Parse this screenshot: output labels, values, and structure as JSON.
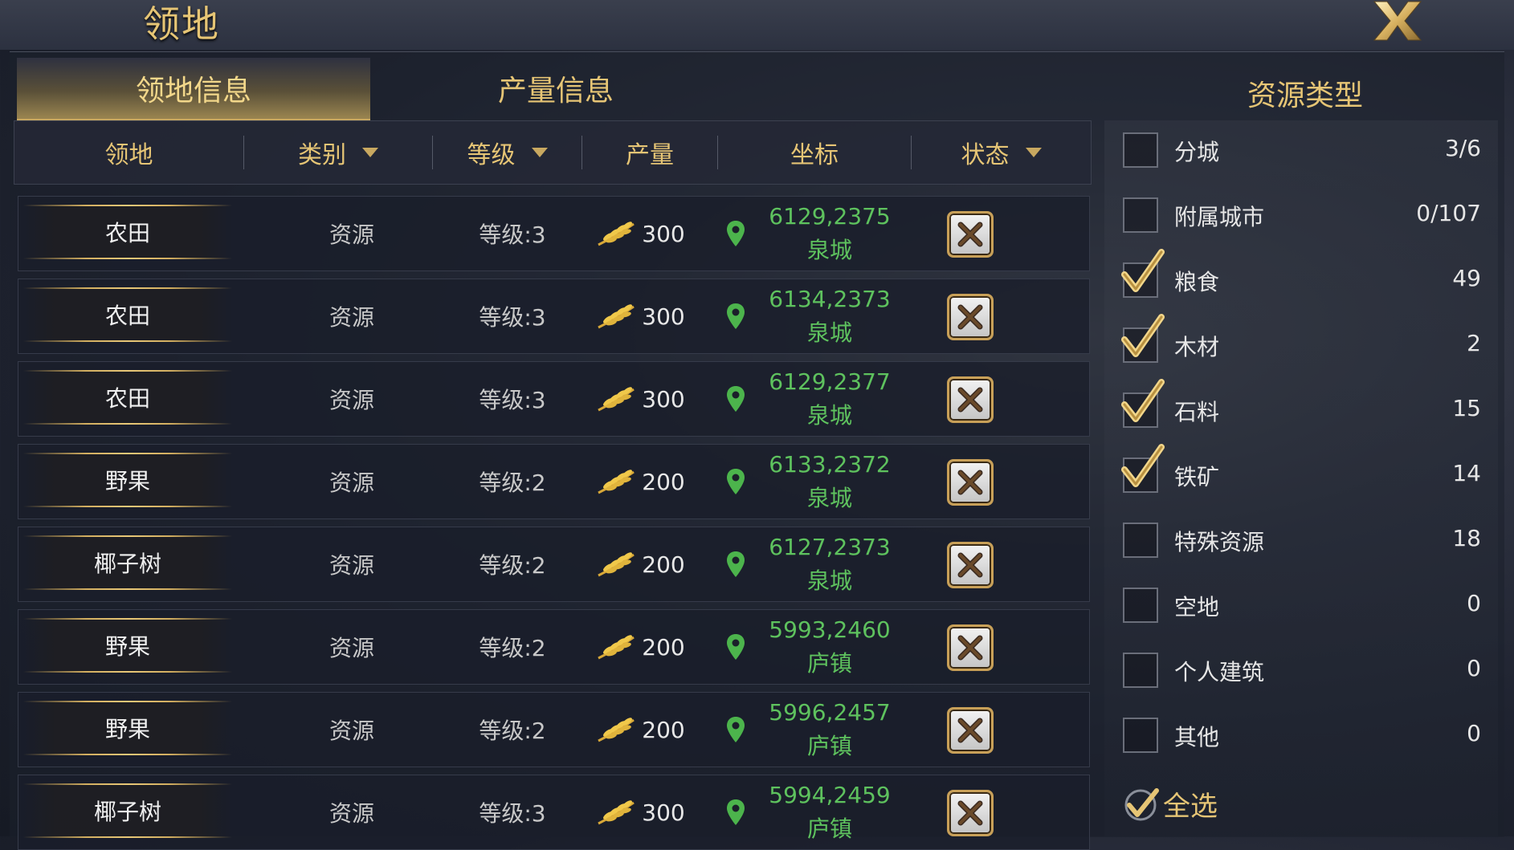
{
  "window": {
    "title": "领地"
  },
  "tabs": [
    {
      "label": "领地信息",
      "active": true
    },
    {
      "label": "产量信息",
      "active": false
    }
  ],
  "filter": {
    "title": "资源类型",
    "items": [
      {
        "label": "分城",
        "count": "3/6",
        "checked": false
      },
      {
        "label": "附属城市",
        "count": "0/107",
        "checked": false
      },
      {
        "label": "粮食",
        "count": "49",
        "checked": true
      },
      {
        "label": "木材",
        "count": "2",
        "checked": true
      },
      {
        "label": "石料",
        "count": "15",
        "checked": true
      },
      {
        "label": "铁矿",
        "count": "14",
        "checked": true
      },
      {
        "label": "特殊资源",
        "count": "18",
        "checked": false
      },
      {
        "label": "空地",
        "count": "0",
        "checked": false
      },
      {
        "label": "个人建筑",
        "count": "0",
        "checked": false
      },
      {
        "label": "其他",
        "count": "0",
        "checked": false
      }
    ],
    "select_all_label": "全选"
  },
  "table": {
    "columns": {
      "territory": "领地",
      "category": "类别",
      "level": "等级",
      "output": "产量",
      "coordinates": "坐标",
      "status": "状态"
    },
    "rows": [
      {
        "name": "农田",
        "category": "资源",
        "level": "等级:3",
        "output": "300",
        "coord": "6129,2375",
        "city": "泉城"
      },
      {
        "name": "农田",
        "category": "资源",
        "level": "等级:3",
        "output": "300",
        "coord": "6134,2373",
        "city": "泉城"
      },
      {
        "name": "农田",
        "category": "资源",
        "level": "等级:3",
        "output": "300",
        "coord": "6129,2377",
        "city": "泉城"
      },
      {
        "name": "野果",
        "category": "资源",
        "level": "等级:2",
        "output": "200",
        "coord": "6133,2372",
        "city": "泉城"
      },
      {
        "name": "椰子树",
        "category": "资源",
        "level": "等级:2",
        "output": "200",
        "coord": "6127,2373",
        "city": "泉城"
      },
      {
        "name": "野果",
        "category": "资源",
        "level": "等级:2",
        "output": "200",
        "coord": "5993,2460",
        "city": "庐镇"
      },
      {
        "name": "野果",
        "category": "资源",
        "level": "等级:2",
        "output": "200",
        "coord": "5996,2457",
        "city": "庐镇"
      },
      {
        "name": "椰子树",
        "category": "资源",
        "level": "等级:3",
        "output": "300",
        "coord": "5994,2459",
        "city": "庐镇"
      }
    ]
  },
  "icons": {
    "close": "close-x-icon",
    "wheat": "wheat-icon",
    "location_pin": "location-pin-icon",
    "remove": "remove-x-icon",
    "dropdown": "dropdown-arrow-icon",
    "check": "check-mark-icon"
  },
  "colors": {
    "gold": "#e6c575",
    "green": "#5ec25e"
  }
}
